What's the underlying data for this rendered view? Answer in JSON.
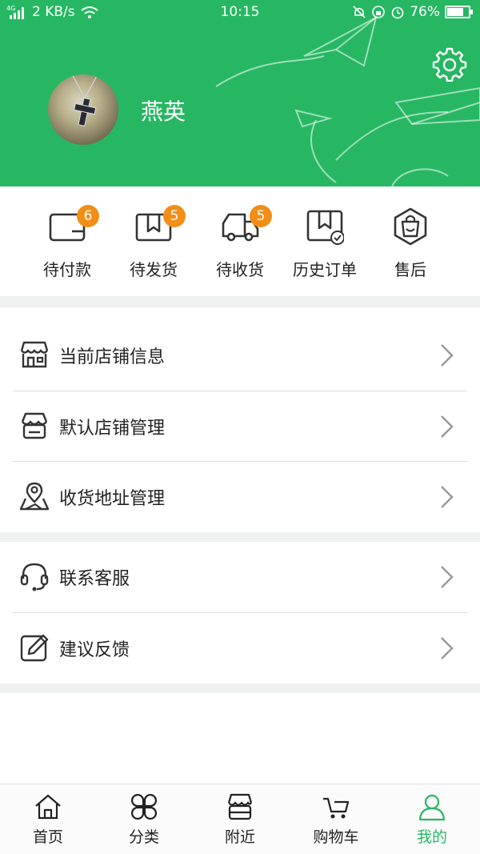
{
  "status_bar": {
    "network": "4G",
    "speed": "2 KB/s",
    "time": "10:15",
    "battery_percent": "76%",
    "battery_level": 0.76
  },
  "profile": {
    "username": "燕英"
  },
  "orders": [
    {
      "label": "待付款",
      "badge": "6",
      "icon": "wallet-icon"
    },
    {
      "label": "待发货",
      "badge": "5",
      "icon": "package-icon"
    },
    {
      "label": "待收货",
      "badge": "5",
      "icon": "truck-icon"
    },
    {
      "label": "历史订单",
      "badge": "",
      "icon": "order-history-icon"
    },
    {
      "label": "售后",
      "badge": "",
      "icon": "after-sales-bag-icon"
    }
  ],
  "menu_group_1": [
    {
      "label": "当前店铺信息",
      "icon": "storefront-icon"
    },
    {
      "label": "默认店铺管理",
      "icon": "shop-manage-icon"
    },
    {
      "label": "收货地址管理",
      "icon": "location-pin-icon"
    }
  ],
  "menu_group_2": [
    {
      "label": "联系客服",
      "icon": "headset-icon"
    },
    {
      "label": "建议反馈",
      "icon": "edit-feedback-icon"
    }
  ],
  "bottom_nav": [
    {
      "label": "首页",
      "icon": "home-icon",
      "active": false
    },
    {
      "label": "分类",
      "icon": "category-clover-icon",
      "active": false
    },
    {
      "label": "附近",
      "icon": "nearby-store-icon",
      "active": false
    },
    {
      "label": "购物车",
      "icon": "cart-icon",
      "active": false
    },
    {
      "label": "我的",
      "icon": "profile-icon",
      "active": true
    }
  ],
  "colors": {
    "brand_green": "#27b763",
    "badge_orange": "#f28d17",
    "separator_gray": "#eff1f0"
  }
}
